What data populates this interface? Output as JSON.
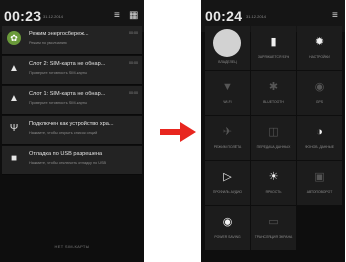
{
  "left_screen": {
    "status": {
      "time": "00:23",
      "date": "31.12.2014"
    },
    "notifications": [
      {
        "icon": "leaf-icon",
        "title": "Режим энергосбереж...",
        "subtitle": "Режим по умолчанию",
        "time": "00:00"
      },
      {
        "icon": "warning-icon",
        "title": "Слот 2: SIM-карта не обнар...",
        "subtitle": "Проверьте готовность SIM-карты",
        "time": "00:00"
      },
      {
        "icon": "warning-icon",
        "title": "Слот 1: SIM-карта не обнар...",
        "subtitle": "Проверьте готовность SIM-карты",
        "time": "00:00"
      },
      {
        "icon": "usb-icon",
        "title": "Подключен как устройство хра...",
        "subtitle": "Нажмите, чтобы открыть список опций",
        "time": ""
      },
      {
        "icon": "bug-icon",
        "title": "Отладка по USB разрешена",
        "subtitle": "Нажмите, чтобы отключить отладку по USB",
        "time": ""
      }
    ],
    "bottom_label": "НЕТ SIM-КАРТЫ"
  },
  "right_screen": {
    "status": {
      "time": "00:24",
      "date": "31.12.2014"
    },
    "tiles": [
      {
        "id": "owner",
        "icon": "avatar-icon",
        "label": "ВЛАДЕЛЕЦ",
        "active": true
      },
      {
        "id": "battery",
        "icon": "battery-icon",
        "label": "ЗАРЯЖАЕТСЯ 93%",
        "active": true
      },
      {
        "id": "settings",
        "icon": "gear-icon",
        "label": "НАСТРОЙКИ",
        "active": true
      },
      {
        "id": "wifi",
        "icon": "wifi-icon",
        "label": "WI-FI",
        "active": false
      },
      {
        "id": "bluetooth",
        "icon": "bluetooth-icon",
        "label": "BLUETOOTH",
        "active": false
      },
      {
        "id": "gps",
        "icon": "gps-icon",
        "label": "GPS",
        "active": false
      },
      {
        "id": "airplane",
        "icon": "airplane-icon",
        "label": "РЕЖИМ ПОЛЁТА",
        "active": false
      },
      {
        "id": "mobile-data",
        "icon": "data-icon",
        "label": "ПЕРЕДАЧА ДАННЫХ",
        "active": false
      },
      {
        "id": "sync",
        "icon": "sync-icon",
        "label": "ФОНОВ. ДАННЫЕ",
        "active": true
      },
      {
        "id": "sound",
        "icon": "volume-icon",
        "label": "ПРОФИЛЬ АУДИО",
        "active": true
      },
      {
        "id": "brightness",
        "icon": "brightness-icon",
        "label": "ЯРКОСТЬ",
        "active": true
      },
      {
        "id": "rotation",
        "icon": "rotation-icon",
        "label": "АВТОПОВОРОТ",
        "active": false
      },
      {
        "id": "power-saving",
        "icon": "power-saving-icon",
        "label": "POWER SAVING",
        "active": true
      },
      {
        "id": "cast",
        "icon": "cast-icon",
        "label": "ТРАНСЛЯЦИЯ ЭКРАНА",
        "active": false
      }
    ]
  },
  "colors": {
    "arrow": "#e8261f",
    "screen_bg": "#0e0e0e",
    "card_bg": "#232323"
  }
}
